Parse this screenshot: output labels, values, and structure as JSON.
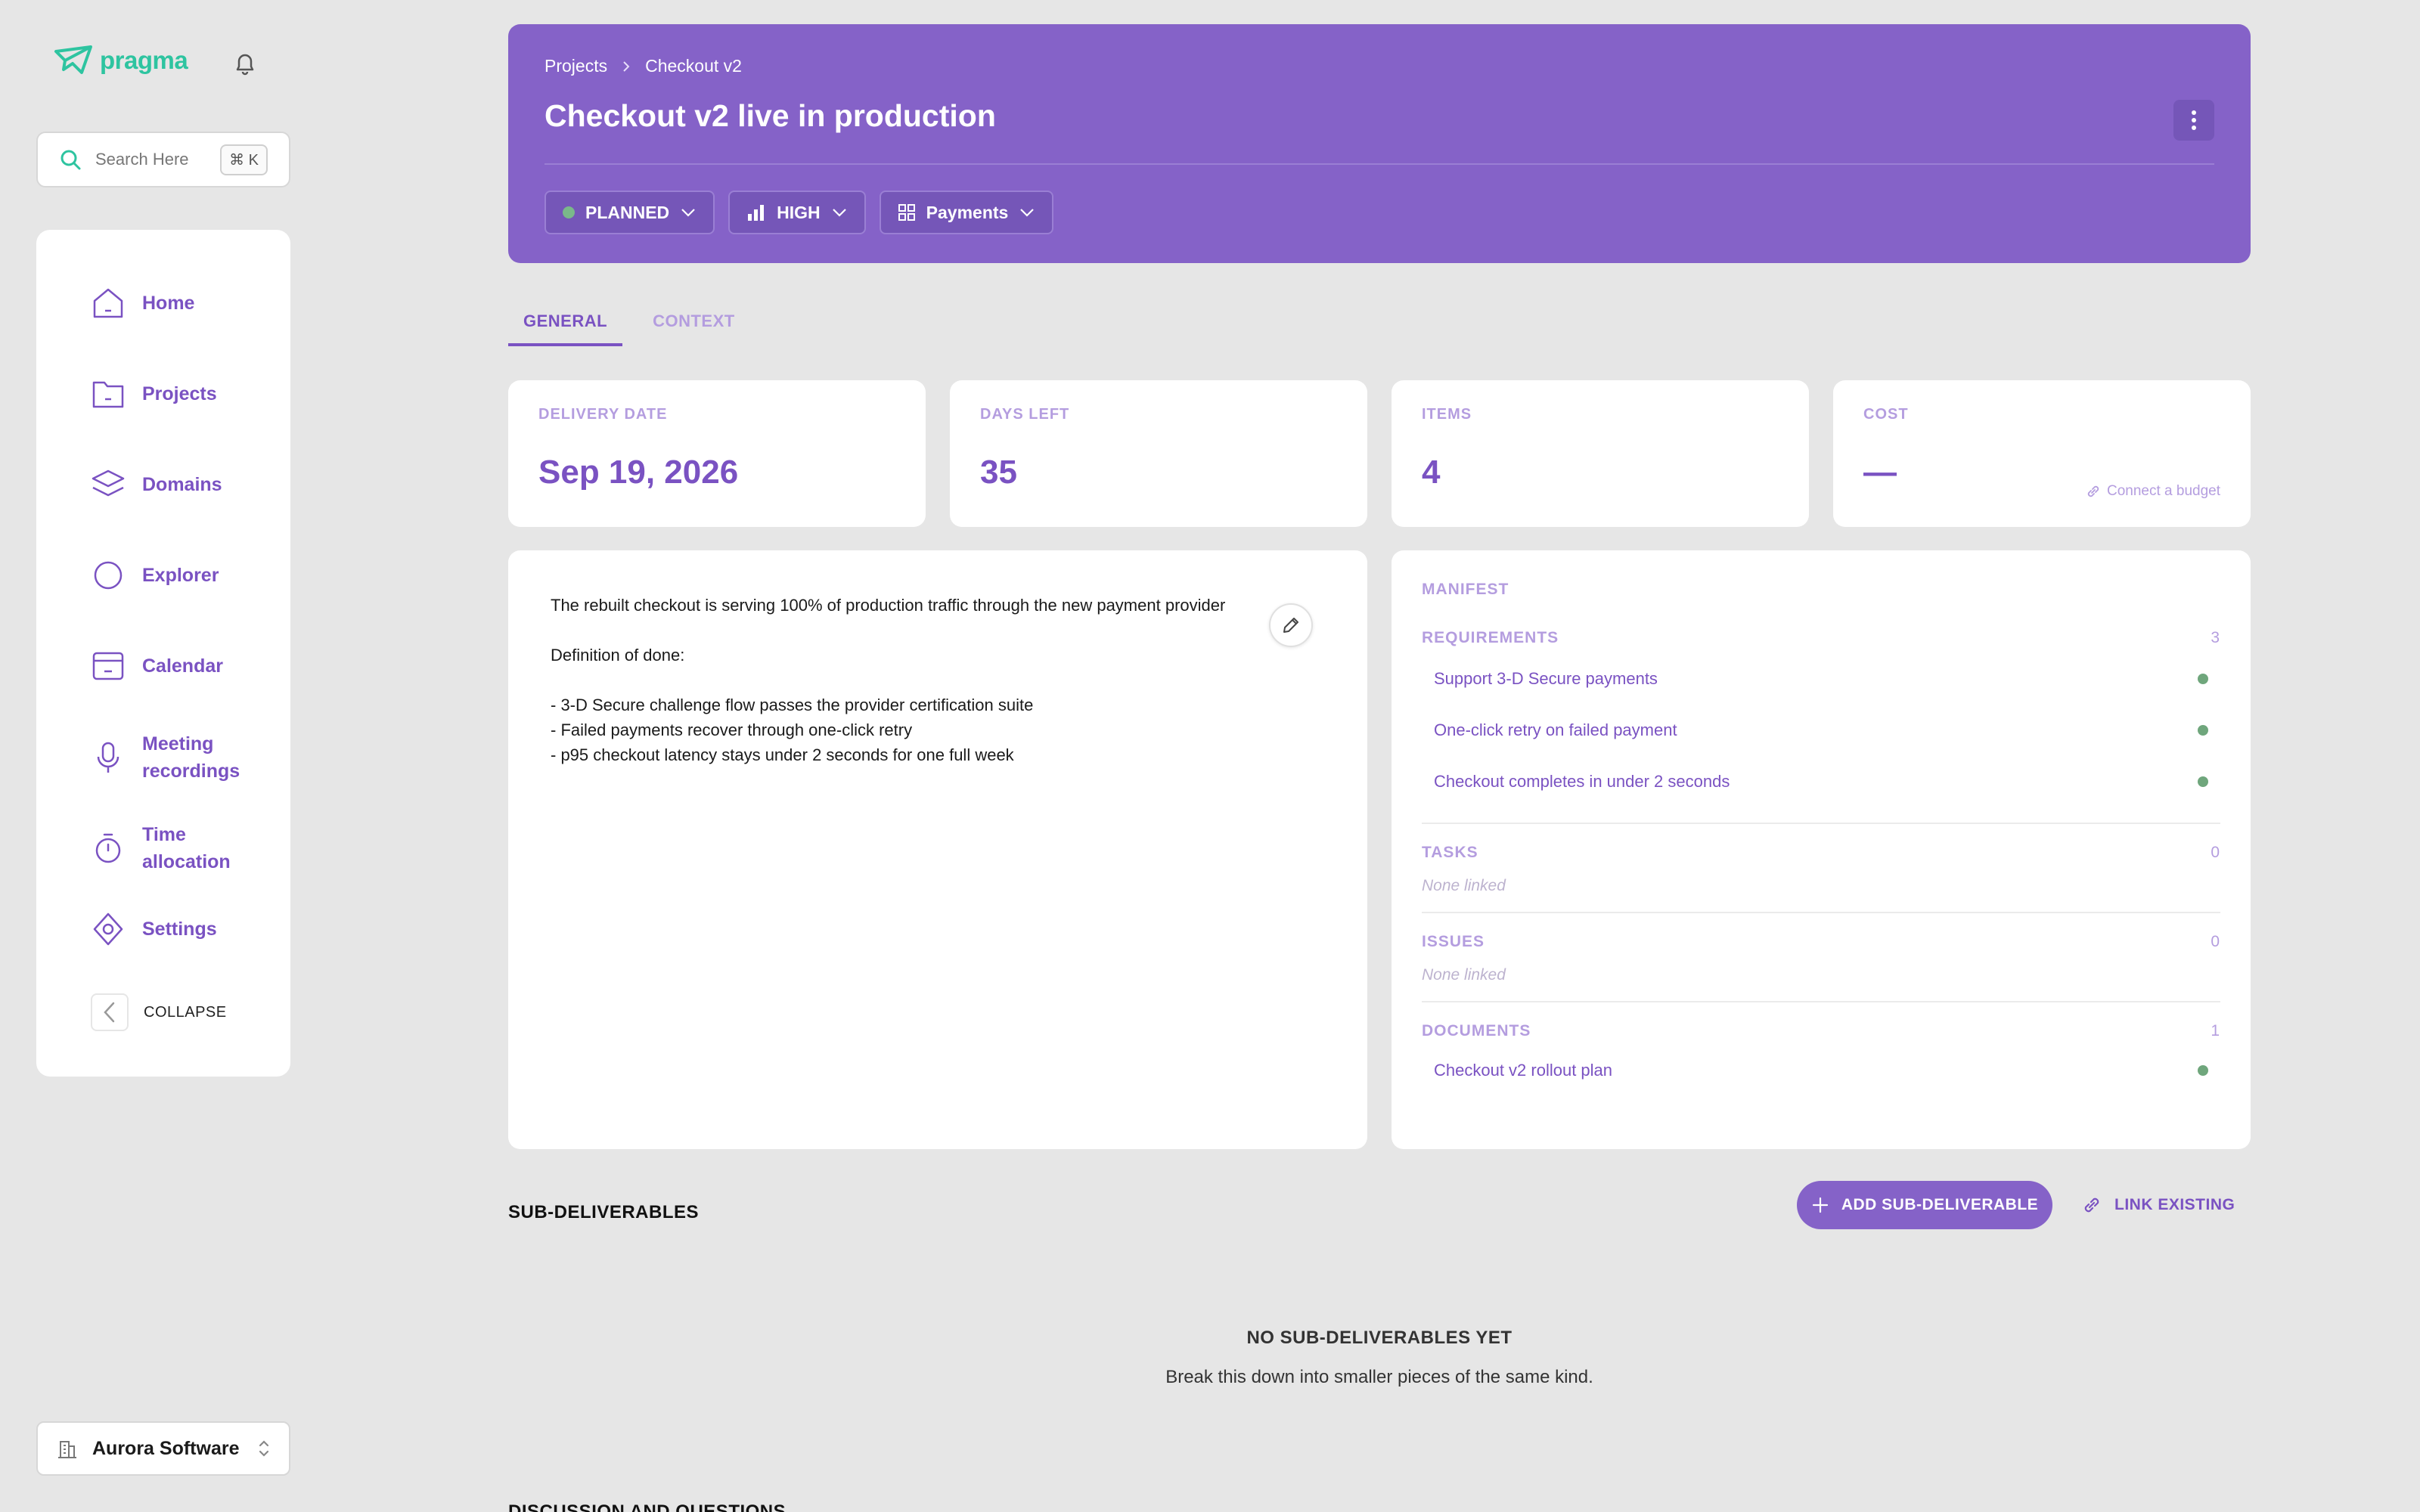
{
  "brand": {
    "name": "pragma",
    "color": "#2ec4a0"
  },
  "search": {
    "placeholder": "Search Here",
    "shortcut": "⌘ K"
  },
  "sidebar": {
    "items": [
      {
        "label": "Home",
        "icon": "home-icon"
      },
      {
        "label": "Projects",
        "icon": "folder-icon"
      },
      {
        "label": "Domains",
        "icon": "layers-icon"
      },
      {
        "label": "Explorer",
        "icon": "circle-icon"
      },
      {
        "label": "Calendar",
        "icon": "calendar-icon"
      },
      {
        "label": "Meeting recordings",
        "icon": "microphone-icon"
      },
      {
        "label": "Time allocation",
        "icon": "stopwatch-icon"
      },
      {
        "label": "Settings",
        "icon": "settings-icon"
      }
    ],
    "collapse_label": "COLLAPSE"
  },
  "org": {
    "name": "Aurora Software"
  },
  "header": {
    "breadcrumb": [
      "Projects",
      "Checkout v2"
    ],
    "title": "Checkout v2 live in production",
    "status": "PLANNED",
    "priority": "HIGH",
    "domain": "Payments",
    "accent": "#8562c8"
  },
  "tabs": [
    {
      "label": "GENERAL",
      "active": true
    },
    {
      "label": "CONTEXT",
      "active": false
    }
  ],
  "stats": {
    "delivery": {
      "label": "DELIVERY DATE",
      "value": "Sep 19, 2026"
    },
    "days_left": {
      "label": "DAYS LEFT",
      "value": "35"
    },
    "items": {
      "label": "ITEMS",
      "value": "4"
    },
    "cost": {
      "label": "COST",
      "value": "—",
      "link": "Connect a budget"
    }
  },
  "description": {
    "intro": "The rebuilt checkout is serving 100% of production traffic through the new payment provider",
    "dod_heading": "Definition of done:",
    "dod_items": [
      "- 3-D Secure challenge flow passes the provider certification suite",
      "- Failed payments recover through one-click retry",
      "- p95 checkout latency stays under 2 seconds for one full week"
    ]
  },
  "manifest": {
    "title": "MANIFEST",
    "requirements": {
      "label": "REQUIREMENTS",
      "count": "3",
      "items": [
        "Support 3-D Secure payments",
        "One-click retry on failed payment",
        "Checkout completes in under 2 seconds"
      ]
    },
    "tasks": {
      "label": "TASKS",
      "count": "0",
      "empty": "None linked"
    },
    "issues": {
      "label": "ISSUES",
      "count": "0",
      "empty": "None linked"
    },
    "documents": {
      "label": "DOCUMENTS",
      "count": "1",
      "items": [
        "Checkout v2 rollout plan"
      ]
    }
  },
  "sub_deliverables": {
    "title": "SUB-DELIVERABLES",
    "add_label": "ADD SUB-DELIVERABLE",
    "link_label": "LINK EXISTING",
    "empty_title": "NO SUB-DELIVERABLES YET",
    "empty_subtitle": "Break this down into smaller pieces of the same kind."
  },
  "discussion": {
    "title": "DISCUSSION AND QUESTIONS"
  }
}
